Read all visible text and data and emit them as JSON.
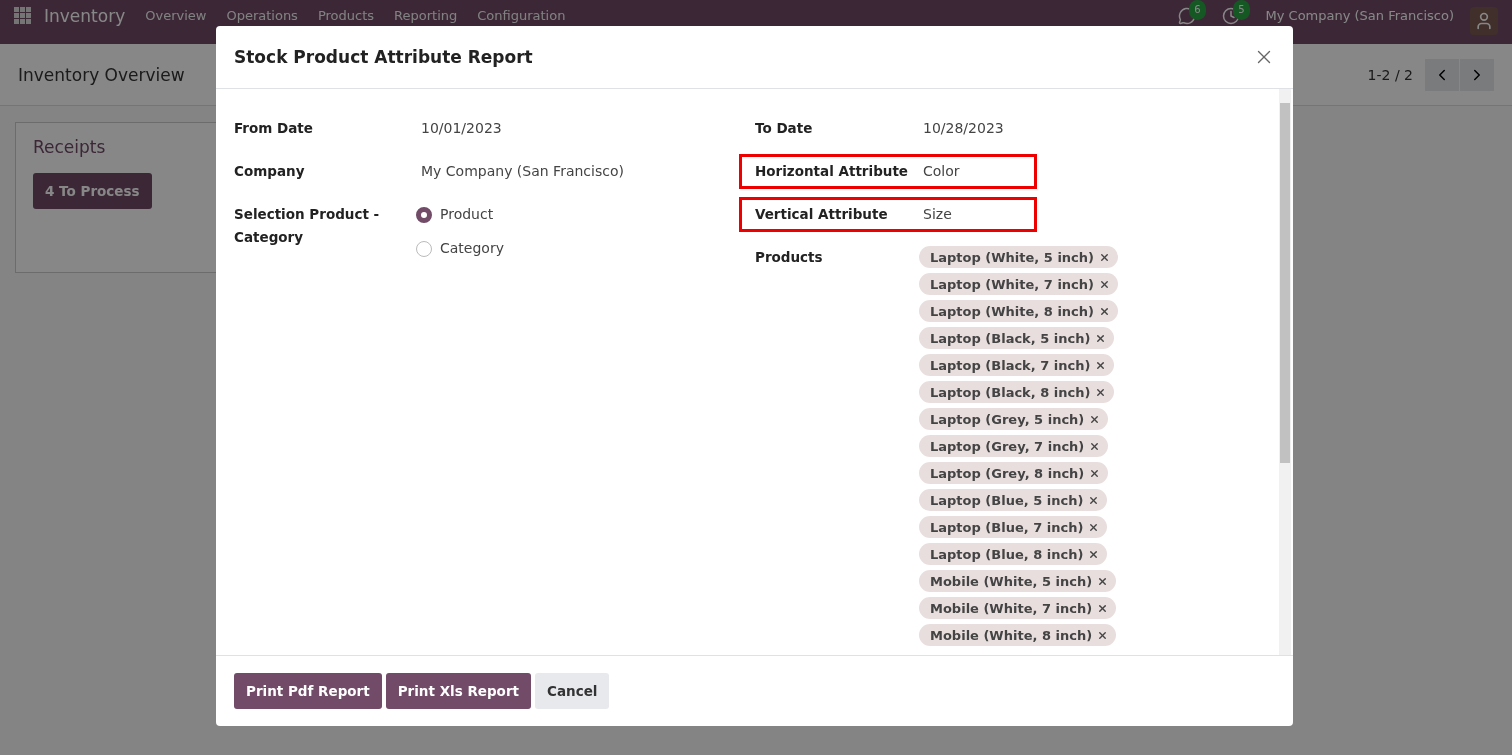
{
  "navbar": {
    "app": "Inventory",
    "menu": [
      "Overview",
      "Operations",
      "Products",
      "Reporting",
      "Configuration"
    ],
    "messages_count": "6",
    "activities_count": "5",
    "company": "My Company (San Francisco)"
  },
  "control_panel": {
    "title": "Inventory Overview",
    "pager": "1-2 / 2"
  },
  "card": {
    "title": "Receipts",
    "button": "4 To Process"
  },
  "dialog": {
    "title": "Stock Product Attribute Report",
    "left_fields": [
      {
        "kind": "text",
        "label": "From Date",
        "value": "10/01/2023"
      },
      {
        "kind": "text",
        "label": "Company",
        "value": "My Company (San Francisco)"
      },
      {
        "kind": "radio",
        "label": "Selection Product - Category",
        "options": [
          {
            "label": "Product",
            "selected": true
          },
          {
            "label": "Category",
            "selected": false
          }
        ]
      }
    ],
    "right_fields": [
      {
        "kind": "text",
        "label": "To Date",
        "value": "10/28/2023",
        "highlighted": false
      },
      {
        "kind": "text",
        "label": "Horizontal Attribute",
        "value": "Color",
        "highlighted": true
      },
      {
        "kind": "text",
        "label": "Vertical Attribute",
        "value": "Size",
        "highlighted": true
      },
      {
        "kind": "tags",
        "label": "Products",
        "tags": [
          "Laptop (White, 5 inch)",
          "Laptop (White, 7 inch)",
          "Laptop (White, 8 inch)",
          "Laptop (Black, 5 inch)",
          "Laptop (Black, 7 inch)",
          "Laptop (Black, 8 inch)",
          "Laptop (Grey, 5 inch)",
          "Laptop (Grey, 7 inch)",
          "Laptop (Grey, 8 inch)",
          "Laptop (Blue, 5 inch)",
          "Laptop (Blue, 7 inch)",
          "Laptop (Blue, 8 inch)",
          "Mobile (White, 5 inch)",
          "Mobile (White, 7 inch)",
          "Mobile (White, 8 inch)"
        ],
        "highlighted": false
      }
    ],
    "buttons": [
      {
        "label": "Print Pdf Report",
        "kind": "primary"
      },
      {
        "label": "Print Xls Report",
        "kind": "primary"
      },
      {
        "label": "Cancel",
        "kind": "secondary"
      }
    ]
  }
}
